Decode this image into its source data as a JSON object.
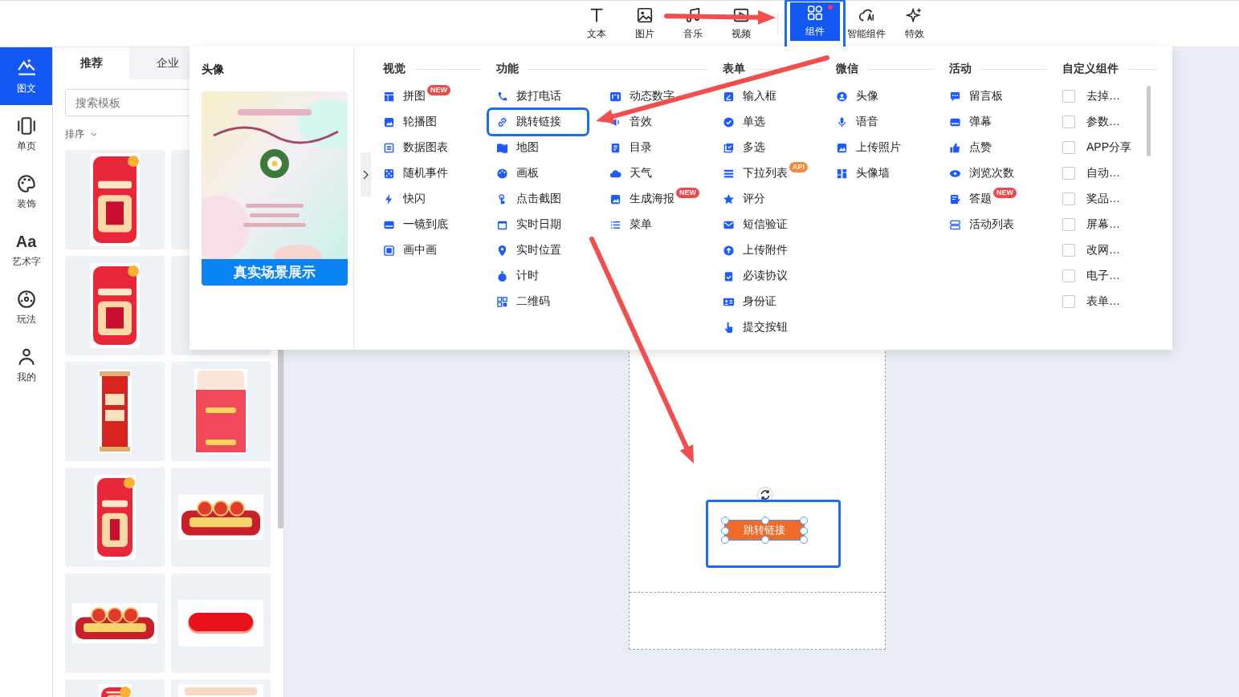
{
  "toolbar": [
    {
      "label": "文本",
      "selected": false,
      "highlighted": false,
      "dot": false
    },
    {
      "label": "图片",
      "selected": false,
      "highlighted": false,
      "dot": false
    },
    {
      "label": "音乐",
      "selected": false,
      "highlighted": false,
      "dot": false
    },
    {
      "label": "视频",
      "selected": false,
      "highlighted": false,
      "dot": false
    },
    {
      "label": "组件",
      "selected": true,
      "highlighted": true,
      "dot": true
    },
    {
      "label": "智能组件",
      "selected": false,
      "highlighted": false,
      "dot": false
    },
    {
      "label": "特效",
      "selected": false,
      "highlighted": false,
      "dot": false
    }
  ],
  "sidebar": {
    "items": [
      {
        "label": "图文",
        "selected": true
      },
      {
        "label": "单页",
        "selected": false
      },
      {
        "label": "装饰",
        "selected": false
      },
      {
        "icon_text": "Aa",
        "label": "艺术字",
        "selected": false
      },
      {
        "label": "玩法",
        "selected": false
      },
      {
        "label": "我的",
        "selected": false
      }
    ]
  },
  "template_panel": {
    "tabs": [
      {
        "label": "推荐",
        "selected": true
      },
      {
        "label": "企业",
        "selected": false
      }
    ],
    "search": {
      "placeholder": "搜索模板"
    },
    "sort": "排序",
    "templates": [
      {
        "kind": "picture"
      },
      {
        "kind": "card"
      },
      {
        "kind": "picture"
      },
      {
        "kind": "card"
      },
      {
        "kind": "picture"
      },
      {
        "kind": "picture"
      },
      {
        "kind": "picture"
      },
      {
        "kind": "picture"
      },
      {
        "kind": "picture"
      },
      {
        "kind": "picture"
      },
      {
        "kind": "picture"
      },
      {
        "kind": "picture"
      }
    ]
  },
  "component_menu": {
    "preview": {
      "title": "头像",
      "picture": {
        "kind": "picture"
      },
      "caption": "真实场景展示"
    },
    "groups": [
      {
        "title": "视觉",
        "kind": "icons",
        "columns": [
          [
            {
              "label": "拼图",
              "badge": {
                "text": "NEW",
                "color": "#f04848"
              },
              "highlighted": false
            },
            {
              "label": "轮播图",
              "highlighted": false
            },
            {
              "label": "数据图表",
              "highlighted": false
            },
            {
              "label": "随机事件",
              "highlighted": false
            },
            {
              "label": "快闪",
              "highlighted": false
            },
            {
              "label": "一镜到底",
              "highlighted": false
            },
            {
              "label": "画中画",
              "highlighted": false
            }
          ]
        ]
      },
      {
        "title": "功能",
        "kind": "icons",
        "columns": [
          [
            {
              "label": "拨打电话",
              "highlighted": false
            },
            {
              "label": "跳转链接",
              "highlighted": true
            },
            {
              "label": "地图",
              "highlighted": false
            },
            {
              "label": "画板",
              "highlighted": false
            },
            {
              "label": "点击截图",
              "highlighted": false
            },
            {
              "label": "实时日期",
              "highlighted": false
            },
            {
              "label": "实时位置",
              "highlighted": false
            },
            {
              "label": "计时",
              "highlighted": false
            },
            {
              "label": "二维码",
              "highlighted": false
            }
          ],
          [
            {
              "label": "动态数字",
              "highlighted": false
            },
            {
              "label": "音效",
              "highlighted": false
            },
            {
              "label": "目录",
              "highlighted": false
            },
            {
              "label": "天气",
              "highlighted": false
            },
            {
              "label": "生成海报",
              "badge": {
                "text": "NEW",
                "color": "#f04848"
              },
              "highlighted": false
            },
            {
              "label": "菜单",
              "highlighted": false
            }
          ]
        ]
      },
      {
        "title": "表单",
        "kind": "icons",
        "columns": [
          [
            {
              "label": "输入框",
              "highlighted": false
            },
            {
              "label": "单选",
              "highlighted": false
            },
            {
              "label": "多选",
              "highlighted": false
            },
            {
              "label": "下拉列表",
              "badge": {
                "text": "API",
                "color": "#f7883a"
              },
              "highlighted": false
            },
            {
              "label": "评分",
              "highlighted": false
            },
            {
              "label": "短信验证",
              "highlighted": false
            },
            {
              "label": "上传附件",
              "highlighted": false
            },
            {
              "label": "必读协议",
              "highlighted": false
            },
            {
              "label": "身份证",
              "highlighted": false
            },
            {
              "label": "提交按钮",
              "highlighted": false
            }
          ]
        ]
      },
      {
        "title": "微信",
        "kind": "icons",
        "columns": [
          [
            {
              "label": "头像",
              "highlighted": false
            },
            {
              "label": "语音",
              "highlighted": false
            },
            {
              "label": "上传照片",
              "highlighted": false
            },
            {
              "label": "头像墙",
              "highlighted": false
            }
          ]
        ]
      },
      {
        "title": "活动",
        "kind": "icons",
        "columns": [
          [
            {
              "label": "留言板",
              "highlighted": false
            },
            {
              "label": "弹幕",
              "highlighted": false
            },
            {
              "label": "点赞",
              "highlighted": false
            },
            {
              "label": "浏览次数",
              "highlighted": false
            },
            {
              "label": "答题",
              "badge": {
                "text": "NEW",
                "color": "#f04848"
              },
              "highlighted": false
            },
            {
              "label": "活动列表",
              "highlighted": false
            }
          ]
        ]
      },
      {
        "title": "自定义组件",
        "kind": "checkboxes",
        "columns": [
          [
            {
              "label": "去掉…",
              "checked": false
            },
            {
              "label": "参数…",
              "checked": false
            },
            {
              "label": "APP分享",
              "checked": false
            },
            {
              "label": "自动…",
              "checked": false
            },
            {
              "label": "奖品…",
              "checked": false
            },
            {
              "label": "屏幕…",
              "checked": false
            },
            {
              "label": "改网…",
              "checked": false
            },
            {
              "label": "电子…",
              "checked": false
            },
            {
              "label": "表单…",
              "checked": false
            }
          ]
        ]
      }
    ]
  },
  "canvas": {
    "selected_element": {
      "label": "跳转链接"
    }
  },
  "annotations": [
    {
      "kind": "arrow"
    },
    {
      "kind": "arrow"
    },
    {
      "kind": "arrow"
    }
  ]
}
